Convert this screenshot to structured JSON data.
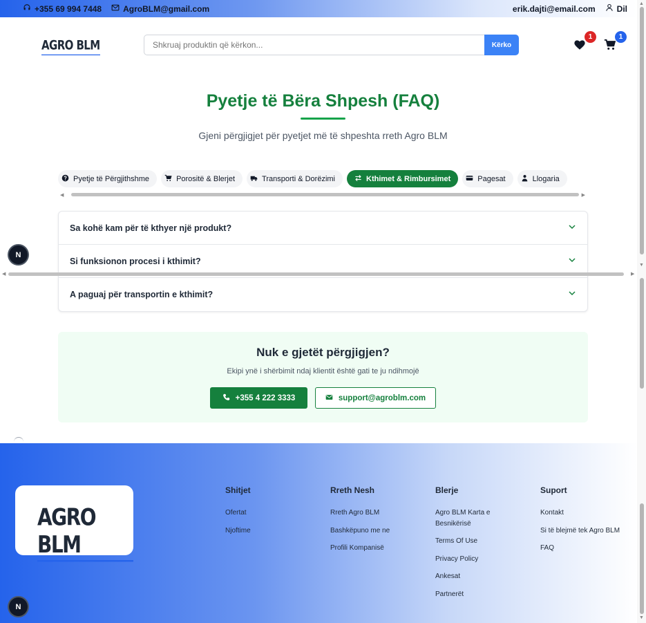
{
  "topbar": {
    "phone": "+355 69 994 7448",
    "email": "AgroBLM@gmail.com",
    "user_email": "erik.dajti@email.com",
    "logout": "Dil"
  },
  "header": {
    "logo": "AGRO BLM",
    "search_placeholder": "Shkruaj produktin që kërkon...",
    "search_button": "Kërko",
    "wishlist_count": "1",
    "cart_count": "1"
  },
  "faq": {
    "title": "Pyetje të Bëra Shpesh (FAQ)",
    "subtitle": "Gjeni përgjigjet për pyetjet më të shpeshta rreth Agro BLM",
    "tabs": [
      {
        "label": "Pyetje të Përgjithshme",
        "icon": "question-circle-icon"
      },
      {
        "label": "Porositë & Blerjet",
        "icon": "cart-icon"
      },
      {
        "label": "Transporti & Dorëzimi",
        "icon": "truck-icon"
      },
      {
        "label": "Kthimet & Rimbursimet",
        "icon": "exchange-icon"
      },
      {
        "label": "Pagesat",
        "icon": "credit-card-icon"
      },
      {
        "label": "Llogaria",
        "icon": "user-icon"
      }
    ],
    "active_tab": "Kthimet & Rimbursimet",
    "questions": [
      "Sa kohë kam për të kthyer një produkt?",
      "Si funksionon procesi i kthimit?",
      "A paguaj për transportin e kthimit?"
    ]
  },
  "help": {
    "title": "Nuk e gjetët përgjigjen?",
    "subtitle": "Ekipi ynë i shërbimit ndaj klientit është gati te ju ndihmojë",
    "phone": "+355 4 222 3333",
    "email": "support@agroblm.com"
  },
  "dev_badge": "N",
  "footer": {
    "logo": "AGRO BLM",
    "columns": [
      {
        "title": "Shitjet",
        "links": [
          "Ofertat",
          "Njoftime"
        ]
      },
      {
        "title": "Rreth Nesh",
        "links": [
          "Rreth Agro BLM",
          "Bashkëpuno me ne",
          "Profili Kompanisë"
        ]
      },
      {
        "title": "Blerje",
        "links": [
          "Agro BLM Karta e Besnikërisë",
          "Terms Of Use",
          "Privacy Policy",
          "Ankesat",
          "Partnerët"
        ]
      },
      {
        "title": "Suport",
        "links": [
          "Kontakt",
          "Si të blejmë tek Agro BLM",
          "FAQ"
        ]
      }
    ]
  },
  "colors": {
    "primary_green": "#15803d",
    "primary_blue": "#2563eb",
    "badge_red": "#dc2626"
  }
}
